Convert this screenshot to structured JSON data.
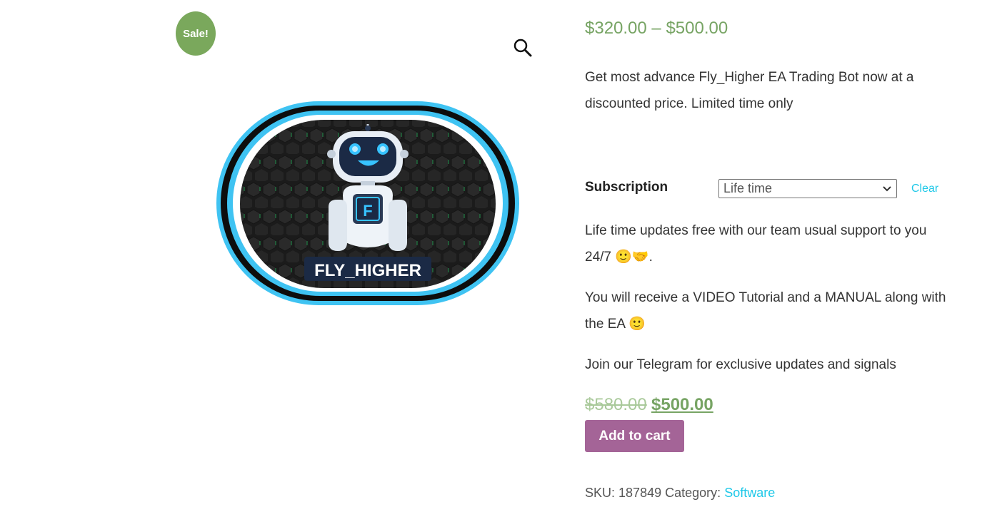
{
  "gallery": {
    "sale_badge": "Sale!",
    "zoom_icon": "magnifier-icon",
    "logo_text": "FLY_HIGHER",
    "robot_chest_letter": "F"
  },
  "summary": {
    "price_range": "$320.00 – $500.00",
    "short_description": "Get most advance Fly_Higher EA Trading Bot now at a discounted price. Limited time only",
    "subscription_label": "Subscription",
    "subscription_selected": "Life time",
    "clear_label": "Clear",
    "variation_paragraph_1": "Life time updates free with our team usual support to you 24/7 🙂🤝.",
    "variation_paragraph_2": "You will receive a VIDEO Tutorial and a MANUAL along with the EA 🙂",
    "variation_paragraph_3": "Join our Telegram for exclusive updates and signals",
    "old_price": "$580.00",
    "new_price": "$500.00",
    "add_to_cart": "Add to cart",
    "sku_label": "SKU:",
    "sku_value": "187849",
    "category_label": "Category:",
    "category_value": "Software"
  },
  "colors": {
    "sale_green": "#7aa85c",
    "price_green": "#77a464",
    "button_purple": "#a46497",
    "link_cyan": "#1ec8e8"
  }
}
